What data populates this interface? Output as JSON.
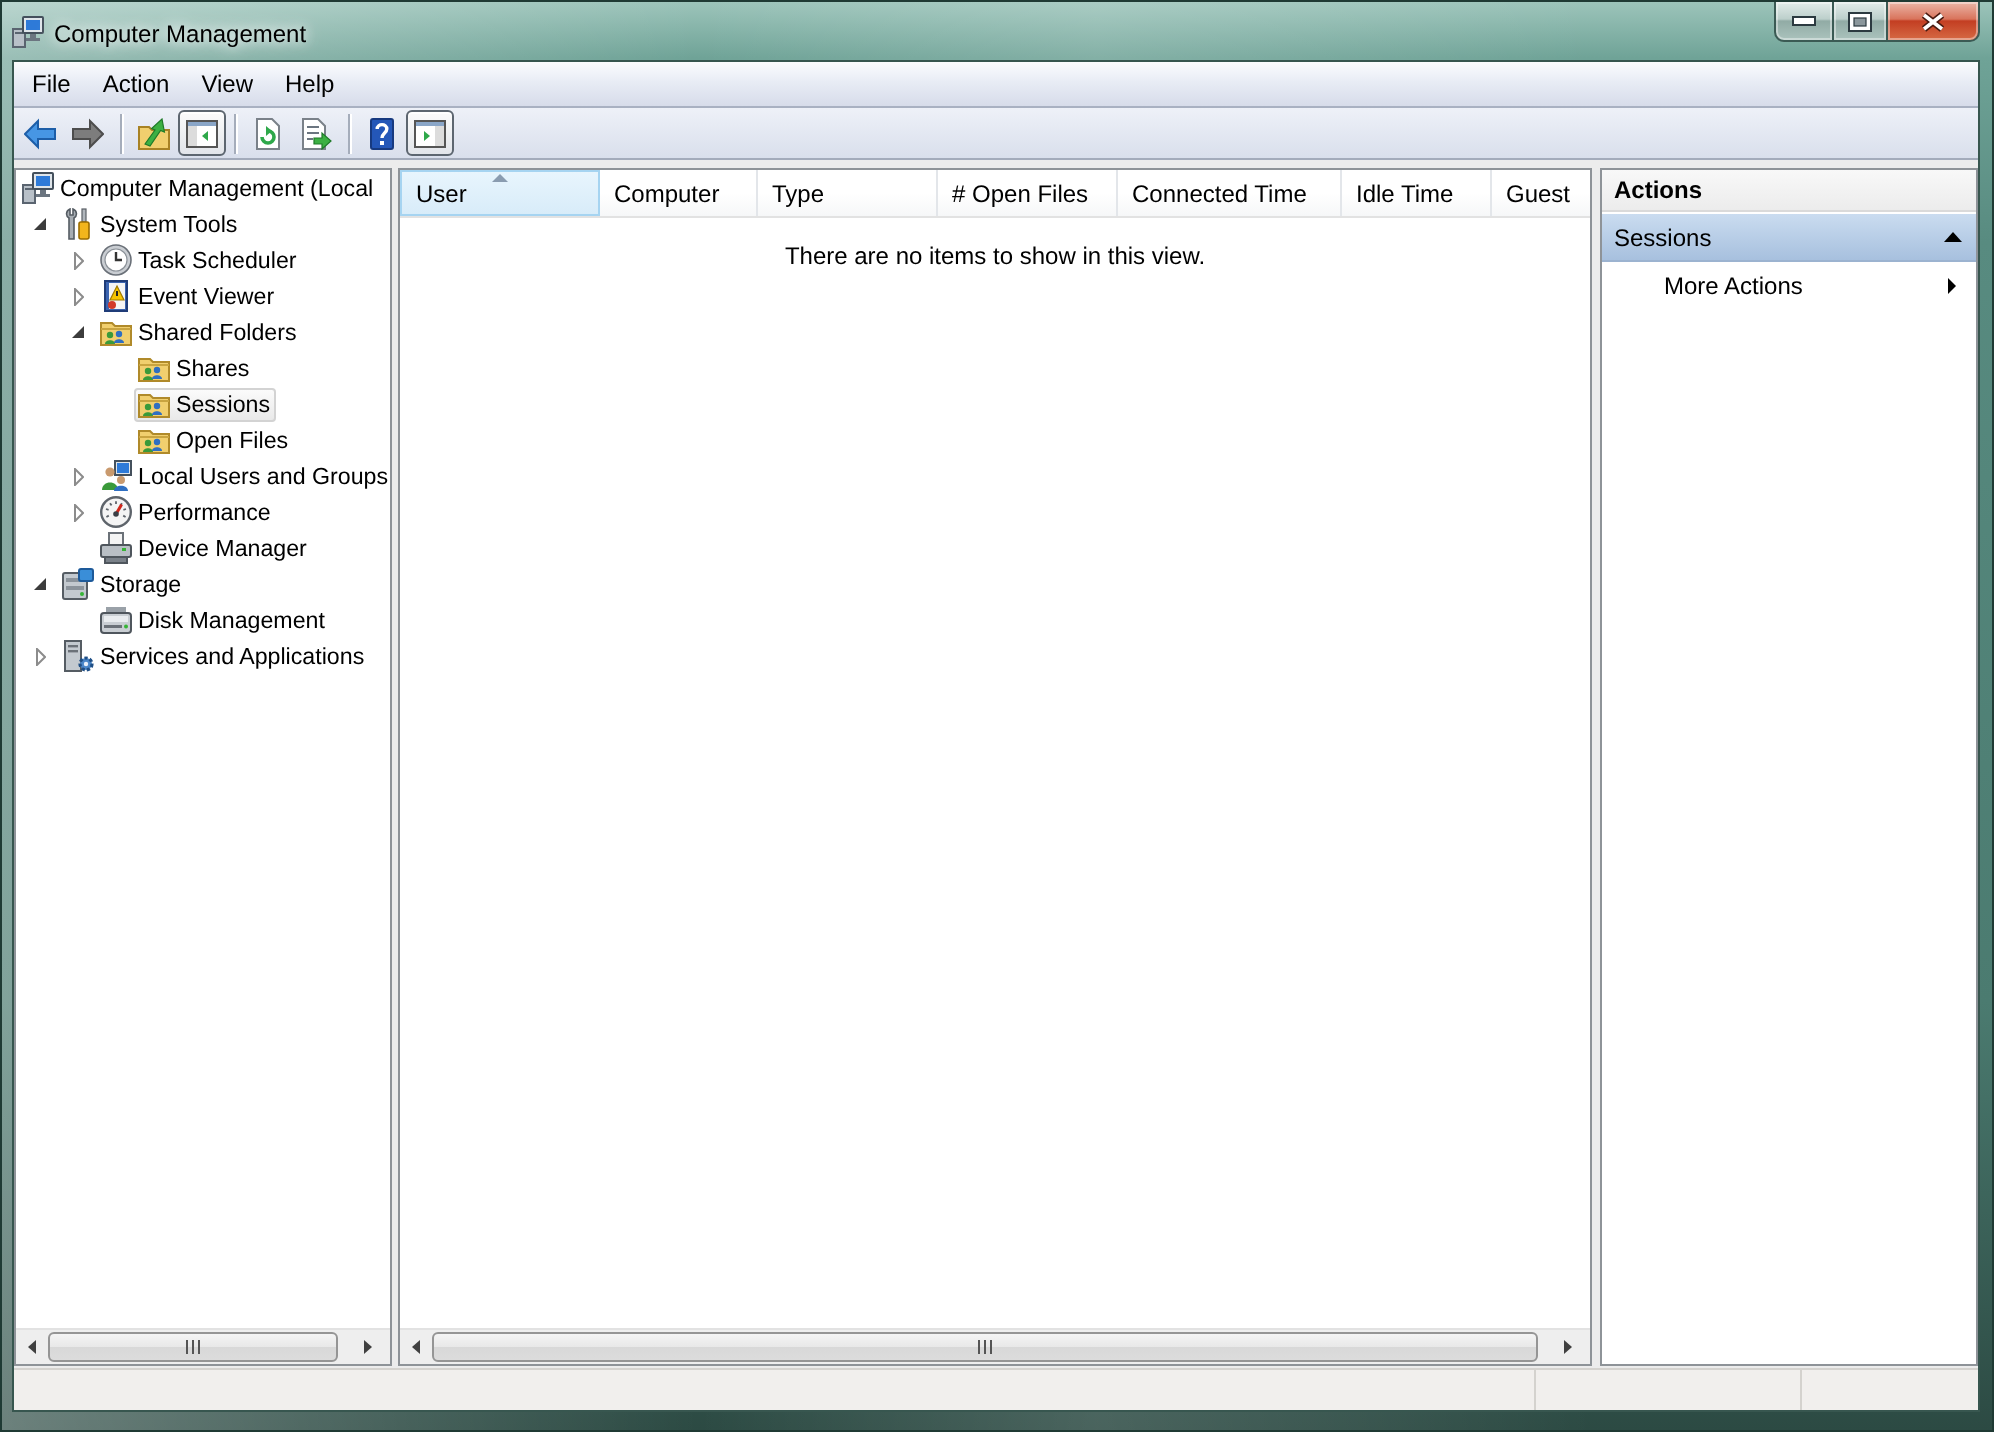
{
  "window": {
    "title": "Computer Management"
  },
  "menu": [
    "File",
    "Action",
    "View",
    "Help"
  ],
  "toolbar": [
    {
      "buttons": [
        {
          "kind": "back",
          "disabled": false,
          "pressed": false
        },
        {
          "kind": "forward",
          "disabled": true,
          "pressed": false
        }
      ]
    },
    {
      "buttons": [
        {
          "kind": "up",
          "disabled": false,
          "pressed": false
        },
        {
          "kind": "tree-pane",
          "disabled": false,
          "pressed": true
        }
      ]
    },
    {
      "buttons": [
        {
          "kind": "refresh",
          "disabled": false,
          "pressed": false
        },
        {
          "kind": "export",
          "disabled": false,
          "pressed": false
        }
      ]
    },
    {
      "buttons": [
        {
          "kind": "help",
          "disabled": false,
          "pressed": false
        },
        {
          "kind": "action-pane",
          "disabled": false,
          "pressed": true
        }
      ]
    }
  ],
  "tree": [
    {
      "label": "Computer Management (Local",
      "kind": "console",
      "selected": false,
      "children": [
        {
          "label": "System Tools",
          "kind": "tools",
          "expanded": true,
          "selected": false,
          "children": [
            {
              "label": "Task Scheduler",
              "kind": "scheduler",
              "expanded": false,
              "selected": false
            },
            {
              "label": "Event Viewer",
              "kind": "event-log",
              "expanded": false,
              "selected": false
            },
            {
              "label": "Shared Folders",
              "kind": "share",
              "expanded": true,
              "selected": false,
              "children": [
                {
                  "label": "Shares",
                  "kind": "share",
                  "selected": false
                },
                {
                  "label": "Sessions",
                  "kind": "share",
                  "selected": true
                },
                {
                  "label": "Open Files",
                  "kind": "share",
                  "selected": false
                }
              ]
            },
            {
              "label": "Local Users and Groups",
              "kind": "users",
              "expanded": false,
              "selected": false
            },
            {
              "label": "Performance",
              "kind": "performance",
              "expanded": false,
              "selected": false
            },
            {
              "label": "Device Manager",
              "kind": "device",
              "selected": false
            }
          ]
        },
        {
          "label": "Storage",
          "kind": "storage",
          "expanded": true,
          "selected": false,
          "children": [
            {
              "label": "Disk Management",
              "kind": "disk",
              "selected": false
            }
          ]
        },
        {
          "label": "Services and Applications",
          "kind": "services",
          "expanded": false,
          "selected": false
        }
      ]
    }
  ],
  "list": {
    "columns": [
      {
        "label": "User",
        "sorted": true
      },
      {
        "label": "Computer",
        "sorted": false
      },
      {
        "label": "Type",
        "sorted": false
      },
      {
        "label": "# Open Files",
        "sorted": false
      },
      {
        "label": "Connected Time",
        "sorted": false
      },
      {
        "label": "Idle Time",
        "sorted": false
      },
      {
        "label": "Guest",
        "sorted": false
      }
    ],
    "empty_message": "There are no items to show in this view."
  },
  "actions": {
    "title": "Actions",
    "sections": [
      {
        "title": "Sessions",
        "expanded": true,
        "items": [
          {
            "label": "More Actions",
            "submenu": true
          }
        ]
      }
    ]
  }
}
